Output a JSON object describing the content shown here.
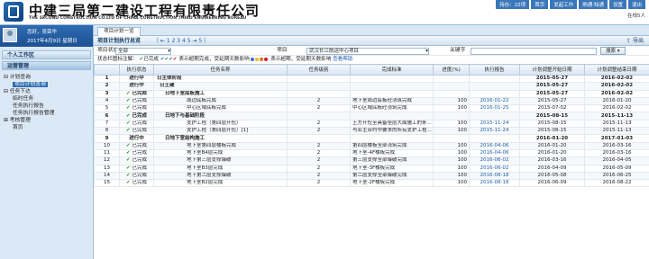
{
  "header": {
    "company_cn": "中建三局第二建设工程有限责任公司",
    "company_en": "THE SECOND CONSTRUCTION CO.LTD OF CHINA CONSTRUCTION THIRD ENGINEERING BUREAU",
    "top_links": [
      "待办：22项",
      "首页",
      "发起工作",
      "刷通·知通",
      "设置",
      "退出"
    ],
    "online": "在线5人"
  },
  "user": {
    "greeting": "您好，吴荣华",
    "date": "2017年4月9日 星期日"
  },
  "sidebar": {
    "panels": [
      "个人工作区",
      "运营管理"
    ],
    "tree": [
      "计划查询",
      "项目计划查询",
      "任务下达",
      "临时任务",
      "任务执行报告",
      "任务执行报告管理",
      "考核管理",
      "首页"
    ]
  },
  "tab": "项目计划一览",
  "titlebar": {
    "title": "项目计划执行总览",
    "pager": "｛ ⇤ 1 2 3 4 5 ⇥ 5 ｝",
    "export": "导出"
  },
  "filters": {
    "status_label": "项目状态",
    "status_value": "全部",
    "project_label": "项目",
    "project_value": "武汉长江航运中心项目",
    "keyword_label": "关键字",
    "keyword_value": "",
    "search_button": "搜索",
    "legend_prefix": "状态栏图标注解：",
    "legend_done": "已完成",
    "legend_blue": "表示超期完成，受延期天数影响",
    "legend_red": "表示超期，受延期天数影响",
    "help": "查看帮助"
  },
  "columns": [
    "",
    "执行状态",
    "任务名称",
    "任务级别",
    "完成标准",
    "进度(%)",
    "执行报告",
    "计划调整开始日期",
    "计划调整结束日期"
  ],
  "rows": [
    {
      "n": "1",
      "st": "进行中",
      "name": "日主体阶段",
      "lvl": "",
      "std": "",
      "pct": "",
      "rep": "",
      "s": "2015-05-27",
      "e": "2016-02-02",
      "bold": true
    },
    {
      "n": "2",
      "st": "进行中",
      "name": "日土建",
      "lvl": "",
      "std": "",
      "pct": "",
      "rep": "",
      "s": "2015-05-27",
      "e": "2016-02-02",
      "bold": true
    },
    {
      "n": "3",
      "st": "已完成",
      "name": "日地下室底板施工",
      "lvl": "",
      "std": "",
      "pct": "",
      "rep": "",
      "s": "2015-05-27",
      "e": "2016-02-02",
      "bold": true
    },
    {
      "n": "4",
      "st": "已完成",
      "name": "周边底板完成",
      "lvl": "2",
      "std": "地下室周边底板砼浇筑完成",
      "pct": "100",
      "rep": "2016-01-22",
      "s": "2015-05-27",
      "e": "2016-01-20",
      "bold": false
    },
    {
      "n": "5",
      "st": "已完成",
      "name": "中心区域底板完成",
      "lvl": "2",
      "std": "中心区域底板砼浇筑完成",
      "pct": "100",
      "rep": "2016-01-25",
      "s": "2015-07-02",
      "e": "2016-02-02",
      "bold": false
    },
    {
      "n": "6",
      "st": "已完成",
      "name": "日地下与基础阶段",
      "lvl": "",
      "std": "",
      "pct": "",
      "rep": "",
      "s": "2015-08-15",
      "e": "2015-11-13",
      "bold": true
    },
    {
      "n": "7",
      "st": "已完成",
      "name": "支护工程（第四层开挖）",
      "lvl": "2",
      "std": "土方开挖至具备垫层大面施工的条...",
      "pct": "100",
      "rep": "2015-11-24",
      "s": "2015-08-15",
      "e": "2015-11-13",
      "bold": false
    },
    {
      "n": "8",
      "st": "已完成",
      "name": "支护工程（第四层开挖）[1]",
      "lvl": "2",
      "std": "与业主合约中要求的所有支护工程...",
      "pct": "100",
      "rep": "2015-11-24",
      "s": "2015-08-15",
      "e": "2015-11-13",
      "bold": false
    },
    {
      "n": "9",
      "st": "进行中",
      "name": "日地下室结构施工",
      "lvl": "",
      "std": "",
      "pct": "",
      "rep": "",
      "s": "2016-01-20",
      "e": "2017-01-03",
      "bold": true
    },
    {
      "n": "10",
      "st": "已完成",
      "name": "地下室第四层楼板完成",
      "lvl": "2",
      "std": "第四层楼板全部浇筑完成",
      "pct": "100",
      "rep": "2016-04-06",
      "s": "2016-01-20",
      "e": "2016-03-16",
      "bold": false
    },
    {
      "n": "11",
      "st": "已完成",
      "name": "地下室B4层完成",
      "lvl": "2",
      "std": "地下室-4F楼板完成",
      "pct": "100",
      "rep": "2016-04-06",
      "s": "2016-01-20",
      "e": "2016-03-16",
      "bold": false
    },
    {
      "n": "12",
      "st": "已完成",
      "name": "地下第三层支撑爆破",
      "lvl": "2",
      "std": "第三层支撑全部爆破完成",
      "pct": "100",
      "rep": "2016-06-02",
      "s": "2016-03-16",
      "e": "2016-04-05",
      "bold": false
    },
    {
      "n": "13",
      "st": "已完成",
      "name": "地下室B3层完成",
      "lvl": "2",
      "std": "地下室-3F楼板完成",
      "pct": "100",
      "rep": "2016-06-02",
      "s": "2016-04-09",
      "e": "2016-05-09",
      "bold": false
    },
    {
      "n": "14",
      "st": "已完成",
      "name": "地下第二层支撑爆破",
      "lvl": "2",
      "std": "第二层支撑全部爆破完成",
      "pct": "100",
      "rep": "2016-08-18",
      "s": "2016-05-08",
      "e": "2016-06-25",
      "bold": false
    },
    {
      "n": "15",
      "st": "已完成",
      "name": "地下室B2层完成",
      "lvl": "2",
      "std": "地下室-2F楼板完成",
      "pct": "100",
      "rep": "2016-08-18",
      "s": "2016-06-09",
      "e": "2016-08-22",
      "bold": false
    }
  ]
}
